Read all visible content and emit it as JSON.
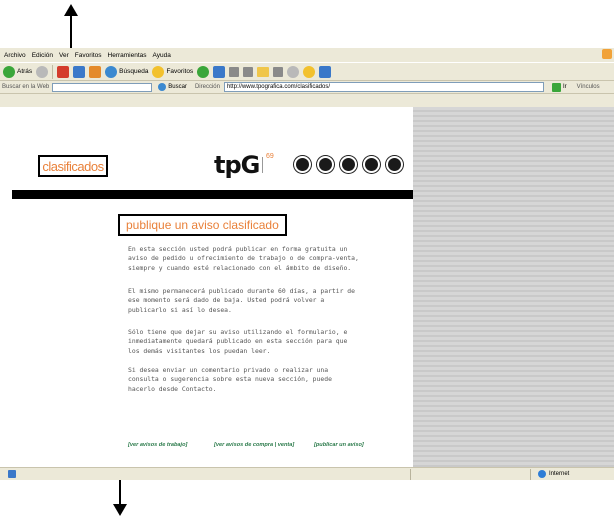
{
  "menu": [
    "Archivo",
    "Edición",
    "Ver",
    "Favoritos",
    "Herramientas",
    "Ayuda"
  ],
  "toolbar": {
    "back_label": "Atrás",
    "search_label": "Búsqueda",
    "favorites_label": "Favoritos"
  },
  "addressbar": {
    "search_web_label": "Buscar en la Web",
    "buscar_label": "Buscar",
    "address_label": "Dirección",
    "url": "http://www.tpografica.com/clasificados/",
    "go_label": "Ir",
    "links_label": "Vínculos"
  },
  "site": {
    "section_title": "clasificados",
    "logo_text": "tpG",
    "logo_sup": "69",
    "headline": "publique un aviso clasificado",
    "paragraphs": [
      "En esta sección usted podrá publicar en forma gratuita un aviso de pedido u ofrecimiento de trabajo o de compra-venta, siempre y cuando esté relacionado con el ámbito de diseño.",
      "El mismo permanecerá publicado durante 60 días, a partir de ese momento será dado de baja. Usted podrá volver a publicarlo si así lo desea.",
      "Sólo tiene que dejar su aviso utilizando el formulario, e inmediatamente quedará publicado en esta sección para que los demás visitantes los puedan leer.",
      "Si desea enviar un comentario privado o realizar una consulta o sugerencia sobre esta nueva sección, puede hacerlo desde Contacto."
    ],
    "links": [
      "[ver avisos de trabajo]",
      "[ver avisos de compra | venta]",
      "[publicar un aviso]"
    ]
  },
  "status": {
    "zone": "Internet"
  },
  "colors": {
    "accent_orange": "#e9813a",
    "link_green": "#2a7a4a"
  }
}
